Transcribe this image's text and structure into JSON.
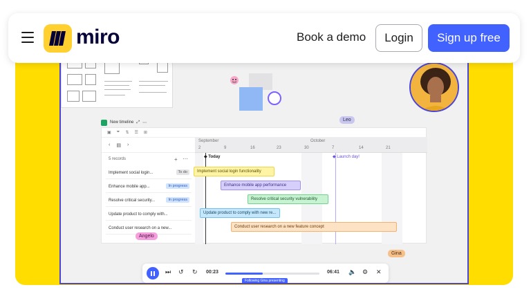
{
  "nav": {
    "logo_text": "miro",
    "book_demo": "Book a demo",
    "login": "Login",
    "signup": "Sign up free"
  },
  "timeline": {
    "title": "New timeline",
    "months": [
      "September",
      "October"
    ],
    "days": [
      "2",
      "9",
      "16",
      "23",
      "30",
      "7",
      "14",
      "21"
    ],
    "record_count": "5 records",
    "today_label": "Today",
    "milestone_label": "Launch day!",
    "rows": [
      {
        "name": "Implement social login...",
        "status": "To do",
        "status_type": "todo"
      },
      {
        "name": "Enhance mobile app...",
        "status": "In progress",
        "status_type": "progress"
      },
      {
        "name": "Resolve critical security...",
        "status": "In progress",
        "status_type": "progress"
      },
      {
        "name": "Update product to comply with...",
        "status": "",
        "status_type": ""
      },
      {
        "name": "Conduct user research on a new...",
        "status": "",
        "status_type": ""
      }
    ],
    "bars": [
      {
        "label": "Implement social login functionality"
      },
      {
        "label": "Enhance mobile app performance"
      },
      {
        "label": "Resolve critical security vulnerability"
      },
      {
        "label": "Update product to comply with new re..."
      },
      {
        "label": "Conduct user research on a new feature concept"
      }
    ]
  },
  "collaborators": {
    "leo": "Leo",
    "angelo": "Angelo",
    "gina": "Gina"
  },
  "player": {
    "current_time": "00:23",
    "total_time": "06:41",
    "progress": 0.4,
    "follow_label": "Following Gina presenting"
  },
  "colors": {
    "accent": "#4262ff",
    "brand_yellow": "#ffdd00"
  }
}
